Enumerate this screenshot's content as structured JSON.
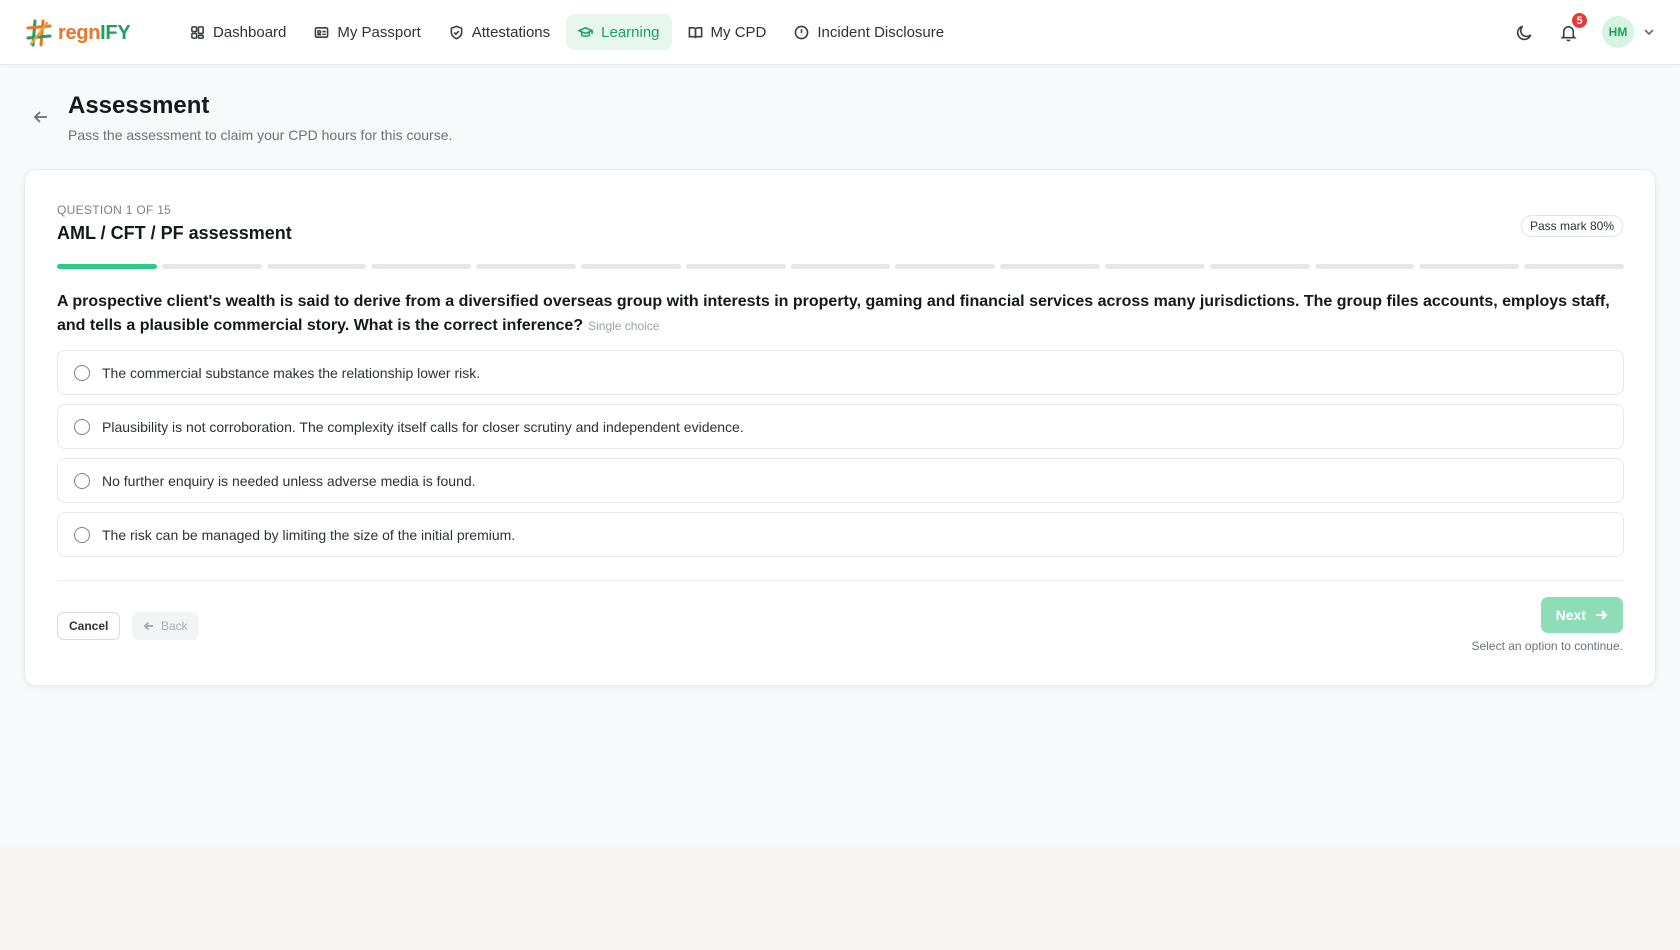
{
  "brand": {
    "name_part1": "regn",
    "name_part2": "IFY"
  },
  "nav": {
    "items": [
      {
        "label": "Dashboard",
        "icon": "dashboard-icon",
        "active": false
      },
      {
        "label": "My Passport",
        "icon": "id-card-icon",
        "active": false
      },
      {
        "label": "Attestations",
        "icon": "shield-check-icon",
        "active": false
      },
      {
        "label": "Learning",
        "icon": "graduation-cap-icon",
        "active": true
      },
      {
        "label": "My CPD",
        "icon": "book-open-icon",
        "active": false
      },
      {
        "label": "Incident Disclosure",
        "icon": "alert-circle-icon",
        "active": false
      }
    ]
  },
  "header_right": {
    "notifications_count": "5",
    "avatar_initials": "HM"
  },
  "page": {
    "title": "Assessment",
    "subtitle": "Pass the assessment to claim your CPD hours for this course."
  },
  "assessment": {
    "counter": "QUESTION 1 OF 15",
    "title": "AML / CFT / PF assessment",
    "pass_mark": "Pass mark 80%",
    "total_questions": 15,
    "current_question": 1,
    "question_text": "A prospective client's wealth is said to derive from a diversified overseas group with interests in property, gaming and financial services across many jurisdictions. The group files accounts, employs staff, and tells a plausible commercial story. What is the correct inference?",
    "question_type": "Single choice",
    "options": [
      "The commercial substance makes the relationship lower risk.",
      "Plausibility is not corroboration. The complexity itself calls for closer scrutiny and independent evidence.",
      "No further enquiry is needed unless adverse media is found.",
      "The risk can be managed by limiting the size of the initial premium."
    ]
  },
  "actions": {
    "cancel_label": "Cancel",
    "back_label": "Back",
    "next_label": "Next",
    "next_hint": "Select an option to continue."
  },
  "colors": {
    "accent": "#1f9d63",
    "progress": "#2ec98a",
    "brand_orange": "#e8762b",
    "badge": "#e53935"
  }
}
